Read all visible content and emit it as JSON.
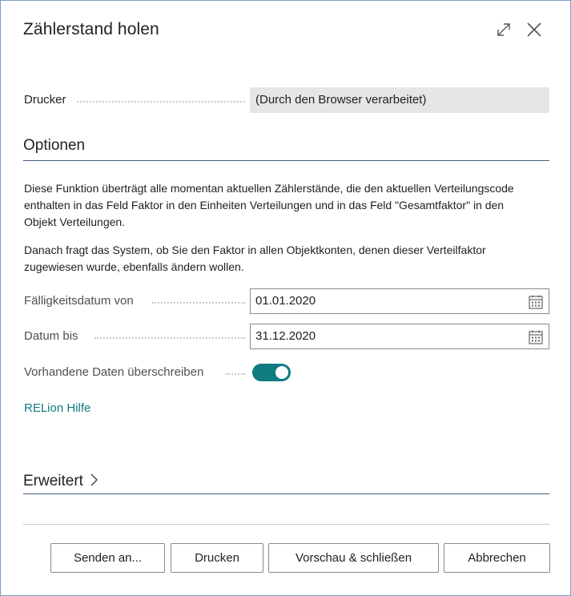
{
  "dialog": {
    "title": "Zählerstand holen",
    "expand_icon": "expand-icon",
    "close_icon": "close-icon"
  },
  "printer": {
    "label": "Drucker",
    "value": "(Durch den Browser verarbeitet)"
  },
  "options": {
    "heading": "Optionen",
    "description_1": "Diese Funktion überträgt alle momentan aktuellen Zählerstände, die den aktuellen Verteilungscode enthalten in das Feld Faktor in den Einheiten Verteilungen und in das Feld \"Gesamtfaktor\" in den Objekt Verteilungen.",
    "description_2": "Danach fragt das System, ob Sie den Faktor in allen Objektkonten, denen dieser Verteilfaktor zugewiesen wurde, ebenfalls ändern wollen.",
    "due_date_from": {
      "label": "Fälligkeitsdatum von",
      "value": "01.01.2020"
    },
    "date_to": {
      "label": "Datum bis",
      "value": "31.12.2020"
    },
    "overwrite": {
      "label": "Vorhandene Daten überschreiben",
      "enabled": true
    },
    "help_link": "RELion Hilfe"
  },
  "advanced": {
    "heading": "Erweitert",
    "chevron_icon": "chevron-right-icon"
  },
  "footer": {
    "send_to": "Senden an...",
    "print": "Drucken",
    "preview_close": "Vorschau & schließen",
    "cancel": "Abbrechen"
  },
  "colors": {
    "accent": "#117b82",
    "section_rule": "#425b80",
    "border": "#7a9cc8"
  }
}
